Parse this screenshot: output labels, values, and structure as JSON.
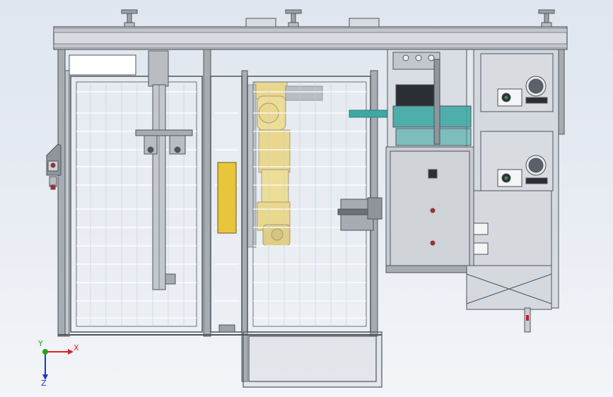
{
  "viewport": {
    "background_top": "#dfe6ef",
    "background_bottom": "#f3f5f8"
  },
  "triad": {
    "x_label": "X",
    "y_label": "Y",
    "z_label": "Z",
    "x_color": "#e0201f",
    "y_color": "#1fa51f",
    "z_color": "#2233cc"
  },
  "model": {
    "frame_color": "#8f959c",
    "frame_dark": "#4e545a",
    "robot_color": "#e9c53c",
    "panel_color": "#c9cdd2",
    "accent_teal": "#3fa8a4",
    "indicator_red": "#c0202a",
    "indicator_green": "#1f9d3a"
  }
}
